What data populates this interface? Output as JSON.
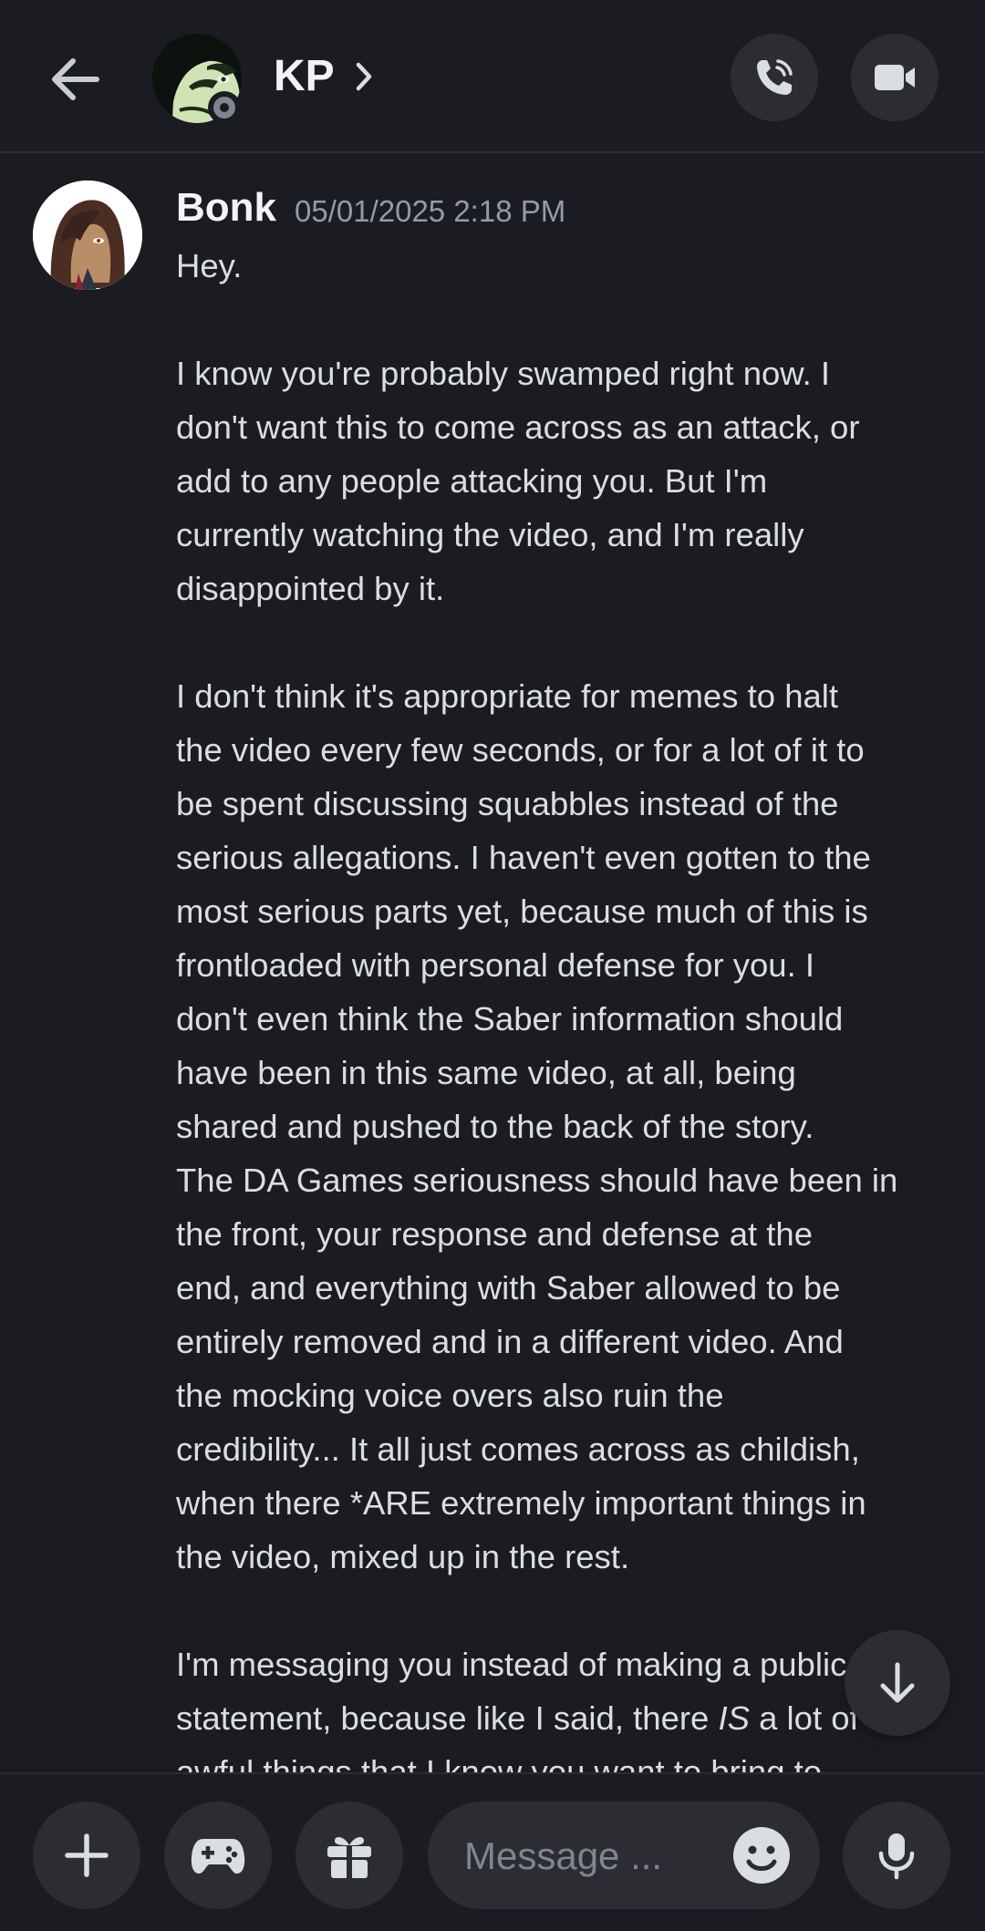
{
  "header": {
    "peer_name": "KP",
    "icons": {
      "back": "arrow-left-icon",
      "chevron": "chevron-right-icon",
      "call": "phone-icon",
      "video": "video-camera-icon",
      "status": "offline-status-icon"
    }
  },
  "message": {
    "author": "Bonk",
    "timestamp": "05/01/2025 2:18 PM",
    "paragraphs": [
      [
        "Hey."
      ],
      [
        "I know you're probably swamped right now. I",
        "don't want this to come across as an attack, or",
        "add to any people attacking you. But I'm",
        "currently watching the video, and I'm really",
        "disappointed by it."
      ],
      [
        "I don't think it's appropriate for memes to halt",
        "the video every few seconds, or for a lot of it to",
        "be spent discussing squabbles instead of the",
        "serious allegations. I haven't even gotten to the",
        "most serious parts yet, because much of this is",
        "frontloaded with personal defense for you. I",
        "don't even think the Saber information should",
        "have been in this same video, at all, being",
        "shared and pushed to the back of the story.",
        "The DA Games seriousness should have been in",
        "the front, your response and defense at the",
        "end, and everything with Saber allowed to be",
        "entirely removed and in a different video. And",
        "the mocking voice overs also ruin the",
        "credibility... It all just comes across as childish,",
        "when there *ARE extremely important things in",
        "the video, mixed up in the rest."
      ],
      {
        "line1": "I'm messaging you instead of making a public",
        "line2_before": "statement, because like I said, there ",
        "line2_emphasis": "IS",
        "line2_after": " a lot of",
        "line3": "awful things that I know you want to bring to"
      }
    ]
  },
  "jump_to_latest": {
    "icon": "arrow-down-icon"
  },
  "composer": {
    "placeholder": "Message ...",
    "icons": {
      "plus": "plus-icon",
      "games": "gamepad-icon",
      "gift": "gift-icon",
      "emoji": "emoji-icon",
      "mic": "microphone-icon"
    }
  },
  "colors": {
    "background": "#1b1c21",
    "surface": "#2b2d33",
    "text_primary": "#f2f3f5",
    "text_body": "#dbdee1",
    "text_muted": "#949ba4"
  }
}
